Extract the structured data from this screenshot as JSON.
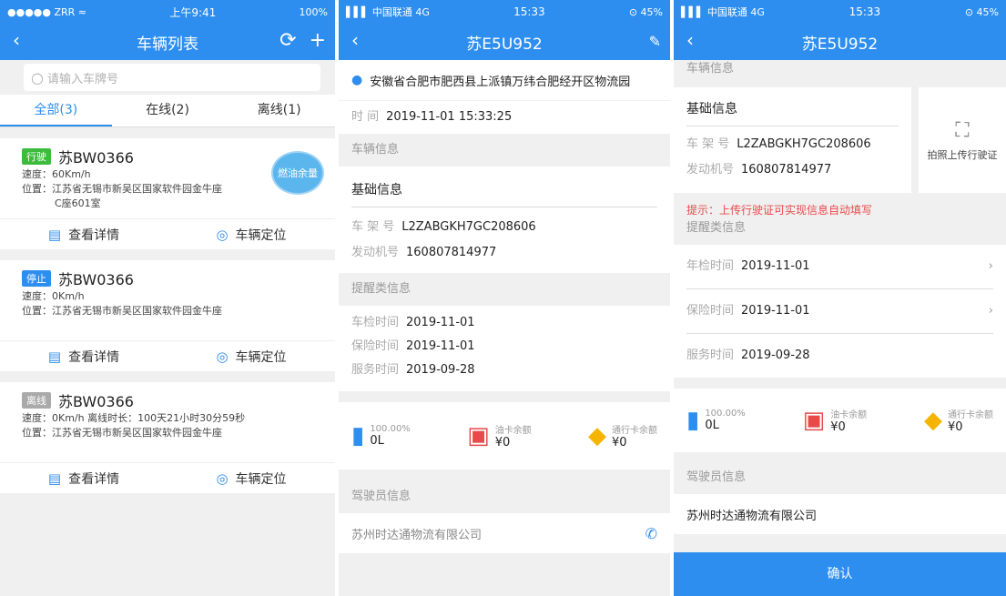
{
  "s1": {
    "status": {
      "left": "●●●●● ZRR ≈",
      "time": "上午9:41",
      "battery": "100%"
    },
    "nav": {
      "back": "‹",
      "title": "车辆列表",
      "refresh": "⟳",
      "add": "+"
    },
    "search": {
      "placeholder": "请输入车牌号"
    },
    "tabs": [
      "全部(3)",
      "在线(2)",
      "离线(1)"
    ],
    "cards": [
      {
        "badge": "行驶",
        "badge_color": "#3dbb3d",
        "plate": "苏BW0366",
        "l1": "速度：60Km/h",
        "l2": "位置：江苏省无锡市新吴区国家软件园金牛座",
        "l3": "C座601室",
        "fuel": "燃油余量"
      },
      {
        "badge": "停止",
        "badge_color": "#2d8ef0",
        "plate": "苏BW0366",
        "l1": "速度：0Km/h",
        "l2": "位置：江苏省无锡市新吴区国家软件园金牛座"
      },
      {
        "badge": "离线",
        "badge_color": "#aaaaaa",
        "plate": "苏BW0366",
        "l1": "速度：0Km/h    离线时长：100天21小时30分59秒",
        "l2": "位置：江苏省无锡市新吴区国家软件园金牛座"
      }
    ],
    "detail": "查看详情",
    "locate": "车辆定位"
  },
  "s2": {
    "status": {
      "left": "▌▌▌ 中国联通  4G",
      "time": "15:33",
      "battery": "⊙ 45%"
    },
    "nav": {
      "back": "‹",
      "title": "苏E5U952",
      "edit": "✎"
    },
    "address": "安徽省合肥市肥西县上派镇万纬合肥经开区物流园",
    "time_label": "时    间",
    "time_value": "2019-11-01 15:33:25",
    "vehicle_info": "车辆信息",
    "basic_info": "基础信息",
    "frame_label": "车 架 号",
    "frame": "L2ZABGKH7GC208606",
    "engine_label": "发动机号",
    "engine": "160807814977",
    "remind": "提醒类信息",
    "inspect_label": "车检时间",
    "inspect": "2019-11-01",
    "insure_label": "保险时间",
    "insure": "2019-11-01",
    "service_label": "服务时间",
    "service": "2019-09-28",
    "fuel_pct": "100.00%",
    "fuel_l": "0L",
    "oilcard_label": "油卡余额",
    "oilcard": "¥0",
    "toll_label": "通行卡余额",
    "toll": "¥0",
    "driver_info": "驾驶员信息",
    "company": "苏州时达通物流有限公司"
  },
  "s3": {
    "status": {
      "left": "▌▌▌ 中国联通  4G",
      "time": "15:33",
      "battery": "⊙ 45%"
    },
    "nav": {
      "back": "‹",
      "title": "苏E5U952"
    },
    "vehicle_info": "车辆信息",
    "basic_info": "基础信息",
    "frame_label": "车 架 号",
    "frame": "L2ZABGKH7GC208606",
    "engine_label": "发动机号",
    "engine": "160807814977",
    "upload": "拍照上传行驶证",
    "tip": "提示：上传行驶证可实现信息自动填写",
    "remind": "提醒类信息",
    "annual_label": "年检时间",
    "annual": "2019-11-01",
    "insure_label": "保险时间",
    "insure": "2019-11-01",
    "service_label": "服务时间",
    "service": "2019-09-28",
    "fuel_pct": "100.00%",
    "fuel_l": "0L",
    "oilcard_label": "油卡余额",
    "oilcard": "¥0",
    "toll_label": "通行卡余额",
    "toll": "¥0",
    "driver_info": "驾驶员信息",
    "company": "苏州时达通物流有限公司",
    "confirm": "确认"
  }
}
